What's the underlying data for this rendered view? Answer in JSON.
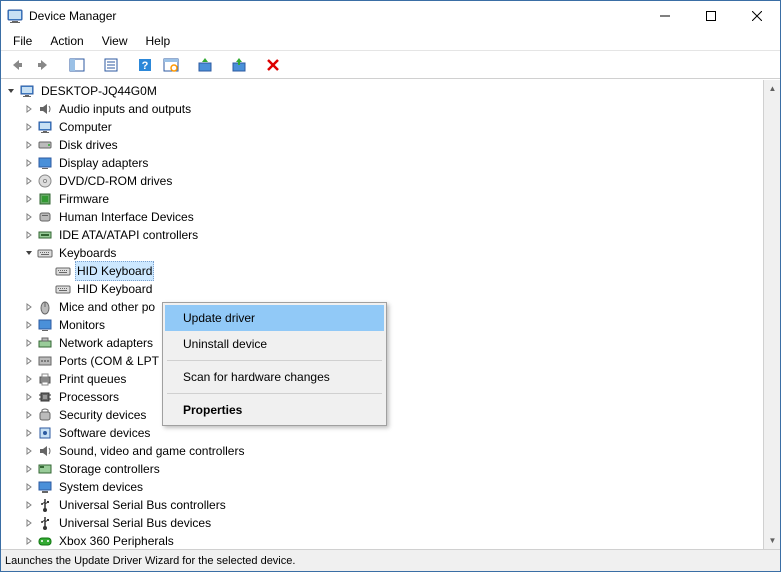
{
  "titlebar": {
    "title": "Device Manager"
  },
  "menubar": {
    "file": "File",
    "action": "Action",
    "view": "View",
    "help": "Help"
  },
  "tree": {
    "root": "DESKTOP-JQ44G0M",
    "items": [
      {
        "label": "Audio inputs and outputs"
      },
      {
        "label": "Computer"
      },
      {
        "label": "Disk drives"
      },
      {
        "label": "Display adapters"
      },
      {
        "label": "DVD/CD-ROM drives"
      },
      {
        "label": "Firmware"
      },
      {
        "label": "Human Interface Devices"
      },
      {
        "label": "IDE ATA/ATAPI controllers"
      },
      {
        "label": "Keyboards",
        "expanded": true,
        "children": [
          {
            "label": "HID Keyboard",
            "selected": true
          },
          {
            "label": "HID Keyboard"
          }
        ]
      },
      {
        "label": "Mice and other po"
      },
      {
        "label": "Monitors"
      },
      {
        "label": "Network adapters"
      },
      {
        "label": "Ports (COM & LPT"
      },
      {
        "label": "Print queues"
      },
      {
        "label": "Processors"
      },
      {
        "label": "Security devices"
      },
      {
        "label": "Software devices"
      },
      {
        "label": "Sound, video and game controllers"
      },
      {
        "label": "Storage controllers"
      },
      {
        "label": "System devices"
      },
      {
        "label": "Universal Serial Bus controllers"
      },
      {
        "label": "Universal Serial Bus devices"
      },
      {
        "label": "Xbox 360 Peripherals"
      }
    ]
  },
  "contextmenu": {
    "update": "Update driver",
    "uninstall": "Uninstall device",
    "scan": "Scan for hardware changes",
    "properties": "Properties"
  },
  "statusbar": {
    "text": "Launches the Update Driver Wizard for the selected device."
  }
}
